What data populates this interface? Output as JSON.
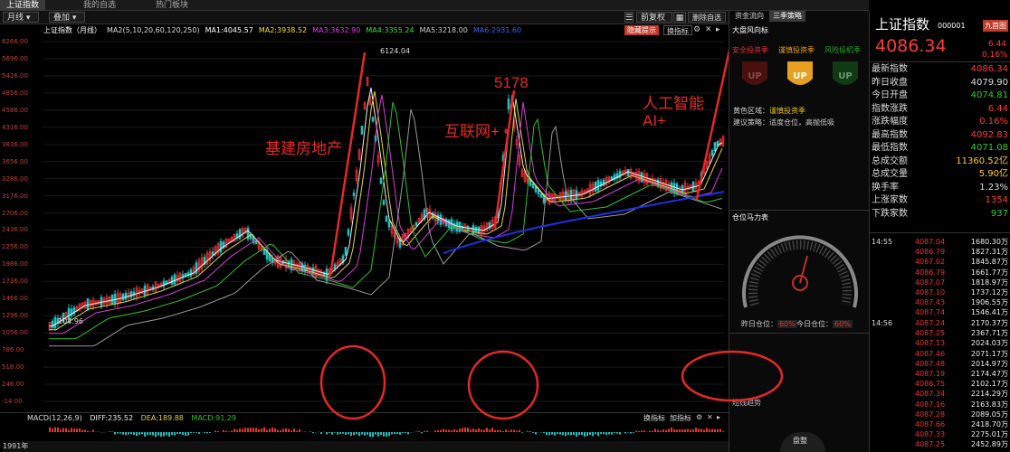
{
  "tabs": [
    {
      "label": "上证指数"
    },
    {
      "label": "我的自选"
    },
    {
      "label": "热门板块"
    }
  ],
  "toolbar": {
    "period": "月线",
    "add": "叠加",
    "rehab": "前复权",
    "stats": "区间统计",
    "remove_self": "删除自选"
  },
  "info": {
    "name": "上证指数（月线）",
    "ma_cfg": "MA2(5,10,20,60,120,250)",
    "ma1": "MA1:4045.57",
    "ma2": "MA2:3938.52",
    "ma3": "MA3:3632.90",
    "ma4": "MA4:3355.24",
    "ma5": "MA5:3218.00",
    "ma6": "MA6:2931.60",
    "hide_btn": "隐藏提示",
    "switch": "换指标"
  },
  "price_ticks": [
    "6266.00",
    "5696.00",
    "5426.00",
    "4856.00",
    "4586.00",
    "4316.00",
    "3836.00",
    "3656.00",
    "3286.00",
    "3176.00",
    "2706.00",
    "2436.00",
    "2256.00",
    "1986.00",
    "1736.00",
    "1466.00",
    "1296.00",
    "1056.00",
    "786.00",
    "516.00",
    "246.00",
    "-14.00"
  ],
  "high_label": "6124.04",
  "low_label": "104.96",
  "annotations": {
    "a1": "基建房地产",
    "a2": "互联网+",
    "a3": "5178",
    "a4": "人工智能",
    "a5": "AI+"
  },
  "macd": {
    "label": "MACD(12,26,9)",
    "diff": "DIFF:235.52",
    "dea": "DEA:189.88",
    "macd": "MACD:91.29",
    "switch": "换指标",
    "add": "加指标",
    "ticks": [
      "900.00",
      "480.00",
      "0.00",
      "-400.00"
    ]
  },
  "bottom": {
    "year": "1991年"
  },
  "mid": {
    "tab1": "资金流向",
    "tab2": "三季策略",
    "title": "大盘风向标",
    "c1": "安全投资季",
    "c2": "谨慎投资季",
    "c3": "风险投机季",
    "zone": "黄色区域：",
    "zone_val": "谨慎投资季",
    "strategy": "建议策略：适度仓位，高抛低吸",
    "gauge_title": "仓位马力表",
    "yesterday": "昨日仓位：",
    "yesterday_val": "60%",
    "today": "今日仓位：",
    "today_val": "60%",
    "bottom1": "盘整",
    "bottom2": "短线趋势"
  },
  "quote": {
    "name": "上证指数",
    "code": "000001",
    "badge": "九首图",
    "price": "4086.34",
    "chg": "6.44",
    "pct": "0.16%",
    "rows": [
      {
        "label": "最新指数",
        "value": "4086.34",
        "color": "#ff3b3b"
      },
      {
        "label": "昨日收盘",
        "value": "4079.90",
        "color": "#dddddd"
      },
      {
        "label": "今日开盘",
        "value": "4074.81",
        "color": "#33cc33"
      },
      {
        "label": "指数涨跌",
        "value": "6.44",
        "color": "#ff3b3b"
      },
      {
        "label": "涨跌幅度",
        "value": "0.16%",
        "color": "#ff3b3b"
      },
      {
        "label": "最高指数",
        "value": "4092.83",
        "color": "#ff3b3b"
      },
      {
        "label": "最低指数",
        "value": "4071.08",
        "color": "#33cc33"
      },
      {
        "label": "总成交额",
        "value": "11360.52亿",
        "color": "#ffcc33"
      },
      {
        "label": "总成交量",
        "value": "5.90亿",
        "color": "#ffcc33"
      },
      {
        "label": "换手率",
        "value": "1.23%",
        "color": "#dddddd"
      },
      {
        "label": "上涨家数",
        "value": "1354",
        "color": "#ff3b3b"
      },
      {
        "label": "下跌家数",
        "value": "937",
        "color": "#33cc33"
      }
    ],
    "ticks": [
      {
        "t": "14:55",
        "p": "4087.04",
        "v": "1680.30万"
      },
      {
        "t": "",
        "p": "4086.79",
        "v": "1827.31万"
      },
      {
        "t": "",
        "p": "4087.02",
        "v": "1845.87万"
      },
      {
        "t": "",
        "p": "4086.79",
        "v": "1661.77万"
      },
      {
        "t": "",
        "p": "4087.07",
        "v": "1818.97万"
      },
      {
        "t": "",
        "p": "4087.10",
        "v": "1737.12万"
      },
      {
        "t": "",
        "p": "4087.43",
        "v": "1906.55万"
      },
      {
        "t": "",
        "p": "4087.74",
        "v": "1546.41万"
      },
      {
        "t": "14:56",
        "p": "4087.24",
        "v": "2170.37万"
      },
      {
        "t": "",
        "p": "4087.25",
        "v": "2367.71万"
      },
      {
        "t": "",
        "p": "4087.13",
        "v": "2024.03万"
      },
      {
        "t": "",
        "p": "4087.46",
        "v": "2071.17万"
      },
      {
        "t": "",
        "p": "4087.48",
        "v": "2014.97万"
      },
      {
        "t": "",
        "p": "4087.19",
        "v": "2174.47万"
      },
      {
        "t": "",
        "p": "4086.75",
        "v": "2102.17万"
      },
      {
        "t": "",
        "p": "4087.34",
        "v": "2214.29万"
      },
      {
        "t": "",
        "p": "4087.16",
        "v": "2163.83万"
      },
      {
        "t": "",
        "p": "4087.28",
        "v": "2089.05万"
      },
      {
        "t": "",
        "p": "4087.66",
        "v": "2418.70万"
      },
      {
        "t": "",
        "p": "4087.33",
        "v": "2275.01万"
      },
      {
        "t": "",
        "p": "4087.25",
        "v": "2452.89万"
      }
    ]
  }
}
